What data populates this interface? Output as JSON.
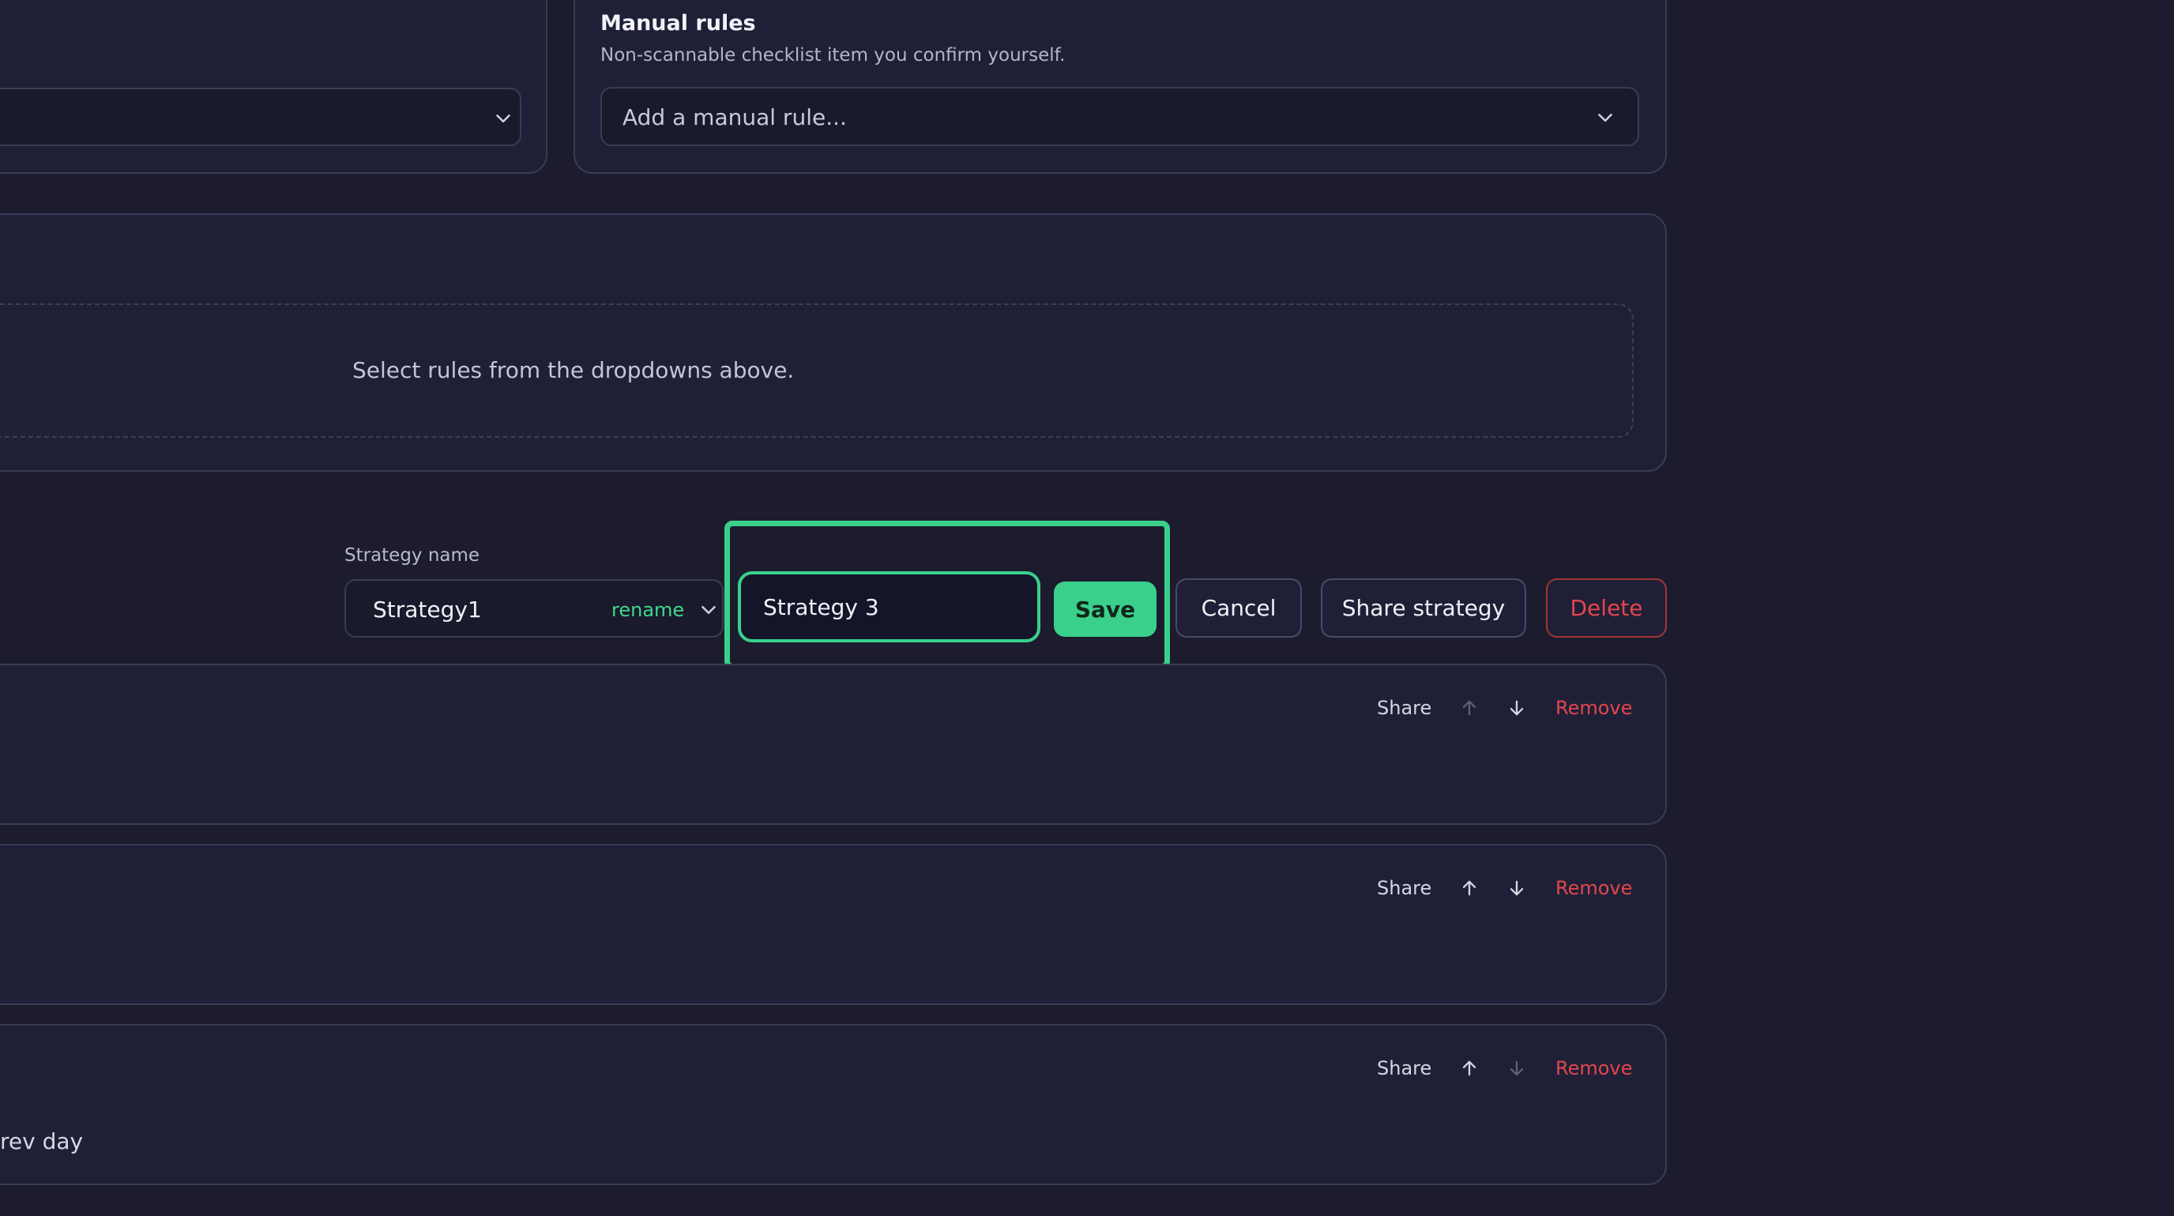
{
  "manual_rules": {
    "title": "Manual rules",
    "subtitle": "Non-scannable checklist item you confirm yourself.",
    "placeholder": "Add a manual rule..."
  },
  "selected_rules": {
    "empty_text": "Select rules from the dropdowns above."
  },
  "strategy": {
    "label": "Strategy name",
    "current": "Strategy1",
    "rename_label": "rename",
    "new_name_value": "Strategy 3",
    "save_label": "Save",
    "cancel_label": "Cancel",
    "share_label": "Share strategy",
    "delete_label": "Delete"
  },
  "rule_rows": [
    {
      "share_label": "Share",
      "remove_label": "Remove",
      "up_enabled": false,
      "down_enabled": true,
      "text": ""
    },
    {
      "share_label": "Share",
      "remove_label": "Remove",
      "up_enabled": true,
      "down_enabled": true,
      "text": ""
    },
    {
      "share_label": "Share",
      "remove_label": "Remove",
      "up_enabled": true,
      "down_enabled": false,
      "text": "rev day"
    }
  ],
  "colors": {
    "accent": "#3ad08c",
    "danger": "#e2464c",
    "background": "#1c1c2e",
    "card": "#1f2037"
  }
}
